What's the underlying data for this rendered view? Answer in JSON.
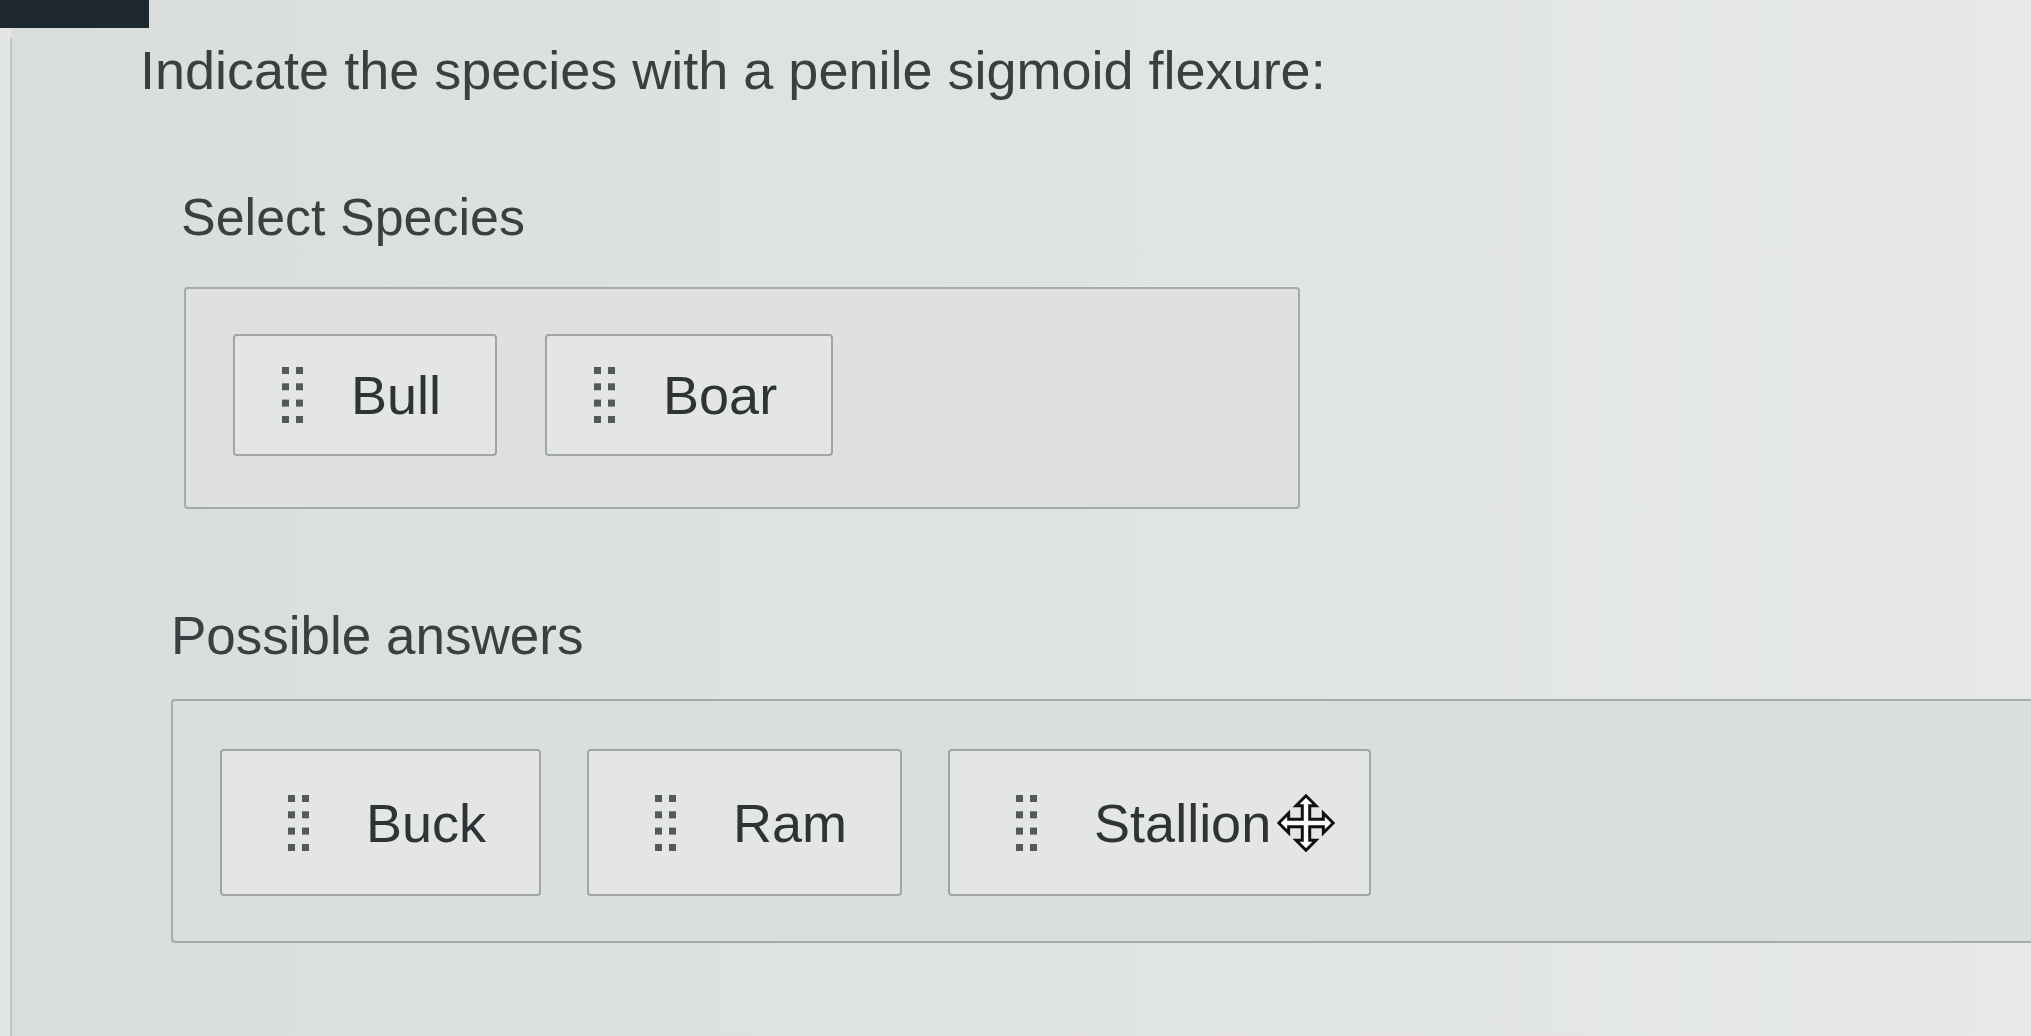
{
  "question": {
    "prompt": "Indicate the species with a penile sigmoid flexure:"
  },
  "drop_zone": {
    "label": "Select Species",
    "items": [
      {
        "label": "Bull"
      },
      {
        "label": "Boar"
      }
    ]
  },
  "answer_bank": {
    "label": "Possible answers",
    "items": [
      {
        "label": "Buck",
        "hovered": false
      },
      {
        "label": "Ram",
        "hovered": false
      },
      {
        "label": "Stallion",
        "hovered": true
      }
    ]
  }
}
